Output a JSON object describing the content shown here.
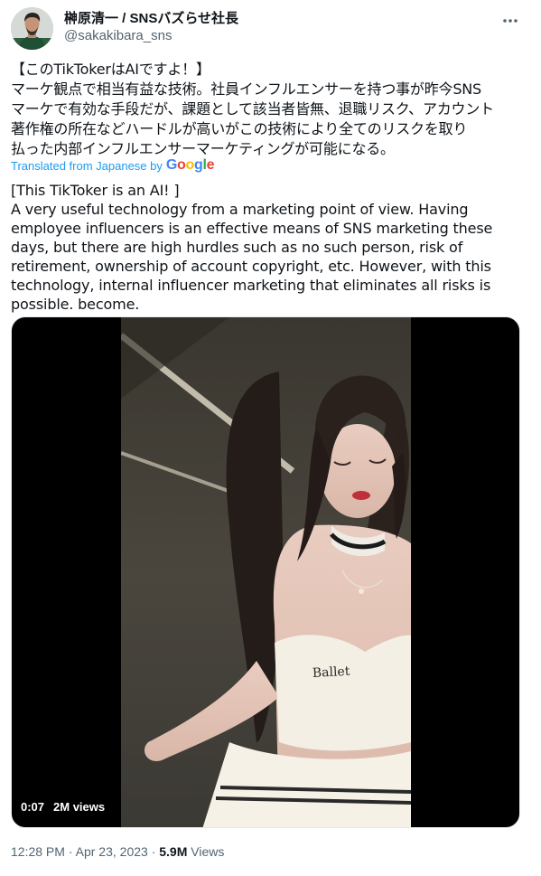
{
  "author": {
    "display_name": "榊原清一 / SNSバズらせ社長",
    "handle": "@sakakibara_sns",
    "avatar_icon": "profile-photo"
  },
  "more_icon": "ellipsis-icon",
  "tweet": {
    "text": "【このTikTokerはAIですよ！】\nマーケ観点で相当有益な技術。社員インフルエンサーを持つ事が昨今SNS\nマーケで有効な手段だが、課題として該当者皆無、退職リスク、アカウント\n著作権の所在などハードルが高いがこの技術により全てのリスクを取り\n払った内部インフルエンサーマーケティングが可能になる。",
    "translated_by_label": "Translated from Japanese by",
    "translator": "Google",
    "translated_text": "[This TikToker is an AI! ]\nA very useful technology from a marketing point of view. Having\nemployee influencers is an effective means of SNS marketing these\ndays, but there are high hurdles such as no such person, risk of\nretirement, ownership of account copyright, etc. However, with this\ntechnology, internal influencer marketing that eliminates all risks is\npossible. become."
  },
  "media": {
    "duration": "0:07",
    "views": "2M views",
    "shirt_text": "Ballet"
  },
  "meta": {
    "time": "12:28 PM",
    "separator": "·",
    "date": "Apr 23, 2023",
    "views_count": "5.9M",
    "views_label": "Views"
  },
  "colors": {
    "link": "#1d9bf0",
    "secondary_text": "#536471",
    "primary_text": "#0f1419"
  }
}
